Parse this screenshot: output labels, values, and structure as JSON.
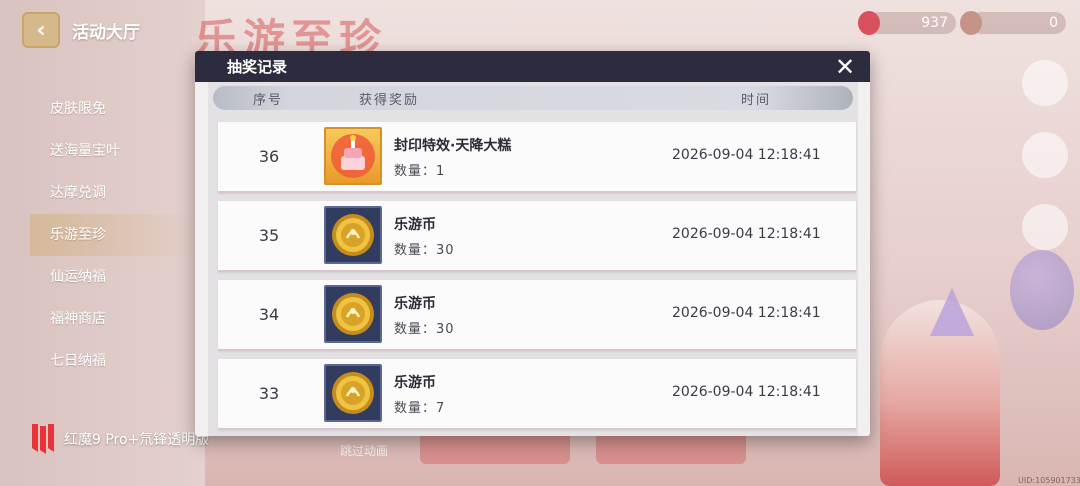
{
  "header": {
    "back_title": "活动大厅",
    "banner": "乐游至珍"
  },
  "currencies": [
    {
      "value": "937"
    },
    {
      "value": "0"
    }
  ],
  "sidebar": {
    "items": [
      {
        "label": "皮肤限免"
      },
      {
        "label": "送海量宝叶"
      },
      {
        "label": "达摩兑调"
      },
      {
        "label": "乐游至珍"
      },
      {
        "label": "仙运纳福"
      },
      {
        "label": "福神商店"
      },
      {
        "label": "七日纳福"
      }
    ]
  },
  "bottom": {
    "skip_text": "跳过动画"
  },
  "watermark": {
    "text": "红魔9 Pro+氘锋透明版"
  },
  "uid": "UID:1059017334",
  "modal": {
    "title": "抽奖记录",
    "close_label": "✕",
    "columns": {
      "index": "序号",
      "reward": "获得奖励",
      "time": "时间"
    },
    "records": [
      {
        "index": "36",
        "icon": "cake-effect-icon",
        "name": "封印特效·天降大糕",
        "qty": "数量：1",
        "time": "2026-09-04 12:18:41"
      },
      {
        "index": "35",
        "icon": "coin-icon",
        "name": "乐游币",
        "qty": "数量：30",
        "time": "2026-09-04 12:18:41"
      },
      {
        "index": "34",
        "icon": "coin-icon",
        "name": "乐游币",
        "qty": "数量：30",
        "time": "2026-09-04 12:18:41"
      },
      {
        "index": "33",
        "icon": "coin-icon",
        "name": "乐游币",
        "qty": "数量：7",
        "time": "2026-09-04 12:18:41"
      }
    ]
  },
  "colors": {
    "header_bg": "#2d2c3e",
    "accent_red": "#d9515d",
    "coin_gold": "#e2b535"
  }
}
